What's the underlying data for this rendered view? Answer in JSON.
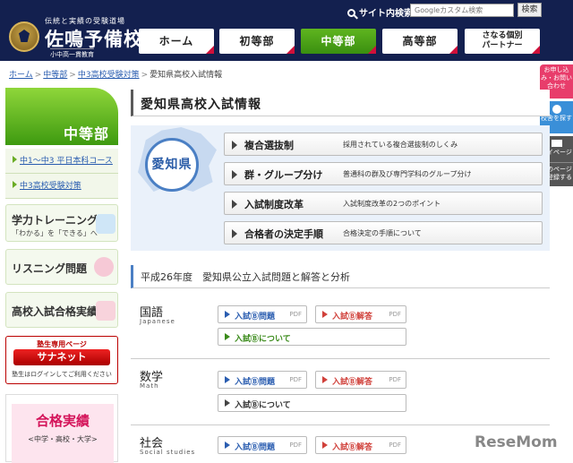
{
  "header": {
    "tagline": "伝統と実績の受験道場",
    "school_name": "佐鳴予備校",
    "school_sub": "小中高一貫教育",
    "site_search_label": "サイト内検索",
    "search_placeholder": "Googleカスタム検索",
    "search_button": "検索",
    "nav": [
      {
        "label": "ホーム"
      },
      {
        "label": "初等部"
      },
      {
        "label": "中等部"
      },
      {
        "label": "高等部"
      },
      {
        "label_line1": "さなる個別",
        "label_line2": "パートナー"
      }
    ]
  },
  "breadcrumb": {
    "items": [
      "ホーム",
      "中等部",
      "中3高校受験対策"
    ],
    "separator": ">",
    "current": "愛知県高校入試情報"
  },
  "float_tabs": {
    "contact": "お申し込み・お問い合わせ",
    "school": "校舎を探す",
    "mypage": "マイページ",
    "bookmark": "このページを登録する"
  },
  "sidebar": {
    "hero": "中等部",
    "links": [
      "中1〜中3 平日本科コース",
      "中3高校受験対策"
    ],
    "banners": {
      "training_title": "学力トレーニング",
      "training_sub": "「わかる」を「できる」へ",
      "listening_title": "リスニング問題",
      "results_title": "高校入試合格実績"
    },
    "sanet": {
      "top": "塾生専用ページ",
      "button": "サナネット",
      "note": "塾生はログインしてご利用ください"
    },
    "gokaku": {
      "title": "合格実績",
      "sub": "<中学・高校・大学>"
    }
  },
  "main": {
    "title": "愛知県高校入試情報",
    "prefecture": "愛知県",
    "menu": [
      {
        "label": "複合選抜制",
        "desc": "採用されている複合選抜制のしくみ"
      },
      {
        "label": "群・グループ分け",
        "desc": "普通科の群及び専門学科のグループ分け"
      },
      {
        "label": "入試制度改革",
        "desc": "入試制度改革の2つのポイント"
      },
      {
        "label": "合格者の決定手順",
        "desc": "合格決定の手順について"
      }
    ],
    "section_title": "平成26年度　愛知県公立入試問題と解答と分析",
    "pdf_tag": "PDF",
    "subjects": [
      {
        "name": "国語",
        "en": "Japanese",
        "question": "入試Ⓑ問題",
        "answer": "入試Ⓑ解答",
        "about": "入試Ⓑについて"
      },
      {
        "name": "数学",
        "en": "Math",
        "question": "入試Ⓑ問題",
        "answer": "入試Ⓑ解答",
        "about": "入試Ⓑについて"
      },
      {
        "name": "社会",
        "en": "Social studies",
        "question": "入試Ⓑ問題",
        "answer": "入試Ⓑ解答"
      }
    ]
  },
  "watermark": "ReseMom"
}
